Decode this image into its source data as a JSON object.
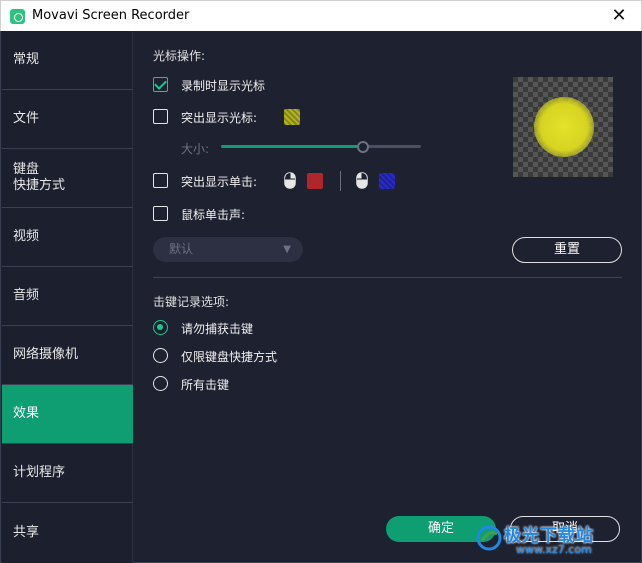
{
  "titlebar": {
    "title": "Movavi Screen Recorder",
    "close_label": "✕"
  },
  "sidebar": {
    "items": [
      {
        "label": "常规"
      },
      {
        "label": "文件"
      },
      {
        "label": "键盘\n快捷方式"
      },
      {
        "label": "视频"
      },
      {
        "label": "音频"
      },
      {
        "label": "网络摄像机"
      },
      {
        "label": "效果",
        "active": true
      },
      {
        "label": "计划程序"
      },
      {
        "label": "共享"
      }
    ]
  },
  "cursor": {
    "section_title": "光标操作:",
    "show_cursor_label": "录制时显示光标",
    "show_cursor_checked": true,
    "highlight_cursor_label": "突出显示光标:",
    "highlight_cursor_checked": false,
    "highlight_color": "#b3b320",
    "size_label": "大小:",
    "size_value": 0.71,
    "highlight_click_label": "突出显示单击:",
    "highlight_click_checked": false,
    "left_click_color": "#b0262c",
    "right_click_color": "#2a2acb",
    "click_sound_label": "鼠标单击声:",
    "click_sound_checked": false,
    "sound_dropdown_value": "默认",
    "reset_label": "重置"
  },
  "keystrokes": {
    "section_title": "击键记录选项:",
    "options": [
      {
        "label": "请勿捕获击键",
        "selected": true
      },
      {
        "label": "仅限键盘快捷方式",
        "selected": false
      },
      {
        "label": "所有击键",
        "selected": false
      }
    ]
  },
  "footer": {
    "ok_label": "确定",
    "cancel_label": "取消"
  },
  "watermark": {
    "text": "极光下载站",
    "url": "www.xz7.com"
  },
  "colors": {
    "accent": "#0f9d72",
    "check": "#17c98f",
    "background": "#1e2130"
  }
}
